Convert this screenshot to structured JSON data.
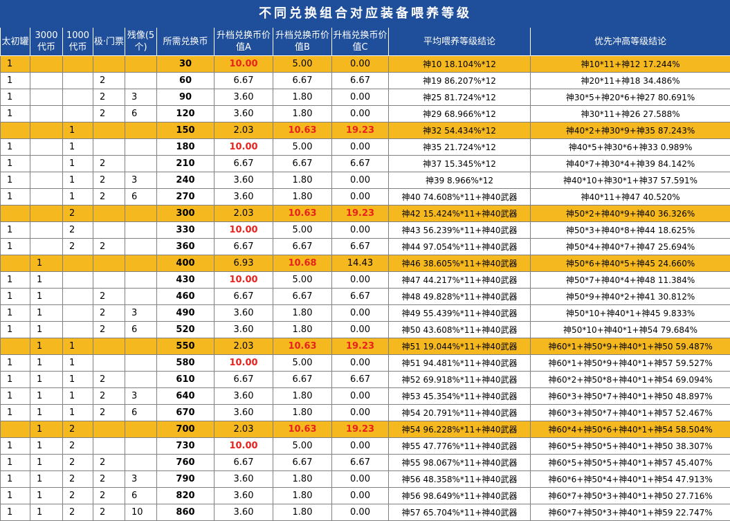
{
  "title": "不同兑换组合对应装备喂养等级",
  "headers": [
    "太初罐",
    "3000代币",
    "1000代币",
    "极·门票",
    "残像(5个)",
    "所需兑换币",
    "升档兑换币价值A",
    "升档兑换币价值B",
    "升档兑换币价值C",
    "平均喂养等级结论",
    "优先冲高等级结论"
  ],
  "highlight_color": "#f5b81f",
  "header_color": "#1f4e9a",
  "red_color": "#e8221c",
  "rows": [
    {
      "hl": true,
      "cells": [
        "1",
        "",
        "",
        "",
        "",
        "30",
        "10.00",
        "5.00",
        "0.00",
        "神10 18.104%*12",
        "神10*11+神12 17.244%"
      ],
      "red": [
        6
      ]
    },
    {
      "hl": false,
      "cells": [
        "1",
        "",
        "",
        "2",
        "",
        "60",
        "6.67",
        "6.67",
        "6.67",
        "神19 86.207%*12",
        "神20*11+神18 34.486%"
      ],
      "red": []
    },
    {
      "hl": false,
      "cells": [
        "1",
        "",
        "",
        "2",
        "3",
        "90",
        "3.60",
        "1.80",
        "0.00",
        "神25 81.724%*12",
        "神30*5+神20*6+神27 80.691%"
      ],
      "red": []
    },
    {
      "hl": false,
      "cells": [
        "1",
        "",
        "",
        "2",
        "6",
        "120",
        "3.60",
        "1.80",
        "0.00",
        "神29 68.966%*12",
        "神30*11+神26 27.588%"
      ],
      "red": []
    },
    {
      "hl": true,
      "cells": [
        "",
        "",
        "1",
        "",
        "",
        "150",
        "2.03",
        "10.63",
        "19.23",
        "神32 54.434%*12",
        "神40*2+神30*9+神35 87.243%"
      ],
      "red": [
        7,
        8
      ]
    },
    {
      "hl": false,
      "cells": [
        "1",
        "",
        "1",
        "",
        "",
        "180",
        "10.00",
        "5.00",
        "0.00",
        "神35 21.724%*12",
        "神40*5+神30*6+神33 0.989%"
      ],
      "red": [
        6
      ]
    },
    {
      "hl": false,
      "cells": [
        "1",
        "",
        "1",
        "2",
        "",
        "210",
        "6.67",
        "6.67",
        "6.67",
        "神37 15.345%*12",
        "神40*7+神30*4+神39 84.142%"
      ],
      "red": []
    },
    {
      "hl": false,
      "cells": [
        "1",
        "",
        "1",
        "2",
        "3",
        "240",
        "3.60",
        "1.80",
        "0.00",
        "神39 8.966%*12",
        "神40*10+神30*1+神37 57.591%"
      ],
      "red": []
    },
    {
      "hl": false,
      "cells": [
        "1",
        "",
        "1",
        "2",
        "6",
        "270",
        "3.60",
        "1.80",
        "0.00",
        "神40 74.608%*11+神40武器",
        "神40*11+神47 40.520%"
      ],
      "red": []
    },
    {
      "hl": true,
      "cells": [
        "",
        "",
        "2",
        "",
        "",
        "300",
        "2.03",
        "10.63",
        "19.23",
        "神42 15.424%*11+神40武器",
        "神50*2+神40*9+神40 36.326%"
      ],
      "red": [
        7,
        8
      ]
    },
    {
      "hl": false,
      "cells": [
        "1",
        "",
        "2",
        "",
        "",
        "330",
        "10.00",
        "5.00",
        "0.00",
        "神43 56.239%*11+神40武器",
        "神50*3+神40*8+神44 18.625%"
      ],
      "red": [
        6
      ]
    },
    {
      "hl": false,
      "cells": [
        "1",
        "",
        "2",
        "2",
        "",
        "360",
        "6.67",
        "6.67",
        "6.67",
        "神44 97.054%*11+神40武器",
        "神50*4+神40*7+神47 25.694%"
      ],
      "red": []
    },
    {
      "hl": true,
      "cells": [
        "",
        "1",
        "",
        "",
        "",
        "400",
        "6.93",
        "10.68",
        "14.43",
        "神46 38.605%*11+神40武器",
        "神50*6+神40*5+神45 24.660%"
      ],
      "red": [
        7
      ]
    },
    {
      "hl": false,
      "cells": [
        "1",
        "1",
        "",
        "",
        "",
        "430",
        "10.00",
        "5.00",
        "0.00",
        "神47 44.217%*11+神40武器",
        "神50*7+神40*4+神48 11.384%"
      ],
      "red": [
        6
      ]
    },
    {
      "hl": false,
      "cells": [
        "1",
        "1",
        "",
        "2",
        "",
        "460",
        "6.67",
        "6.67",
        "6.67",
        "神48 49.828%*11+神40武器",
        "神50*9+神40*2+神41 30.812%"
      ],
      "red": []
    },
    {
      "hl": false,
      "cells": [
        "1",
        "1",
        "",
        "2",
        "3",
        "490",
        "3.60",
        "1.80",
        "0.00",
        "神49 55.439%*11+神40武器",
        "神50*10+神40*1+神45 9.833%"
      ],
      "red": []
    },
    {
      "hl": false,
      "cells": [
        "1",
        "1",
        "",
        "2",
        "6",
        "520",
        "3.60",
        "1.80",
        "0.00",
        "神50 43.608%*11+神40武器",
        "神50*10+神40*1+神54 79.684%"
      ],
      "red": []
    },
    {
      "hl": true,
      "cells": [
        "",
        "1",
        "1",
        "",
        "",
        "550",
        "2.03",
        "10.63",
        "19.23",
        "神51 19.044%*11+神40武器",
        "神60*1+神50*9+神40*1+神50 59.487%"
      ],
      "red": [
        7,
        8
      ]
    },
    {
      "hl": false,
      "cells": [
        "1",
        "1",
        "1",
        "",
        "",
        "580",
        "10.00",
        "5.00",
        "0.00",
        "神51 94.481%*11+神40武器",
        "神60*1+神50*9+神40*1+神57 59.527%"
      ],
      "red": [
        6
      ]
    },
    {
      "hl": false,
      "cells": [
        "1",
        "1",
        "1",
        "2",
        "",
        "610",
        "6.67",
        "6.67",
        "6.67",
        "神52 69.918%*11+神40武器",
        "神60*2+神50*8+神40*1+神54 69.094%"
      ],
      "red": []
    },
    {
      "hl": false,
      "cells": [
        "1",
        "1",
        "1",
        "2",
        "3",
        "640",
        "3.60",
        "1.80",
        "0.00",
        "神53 45.354%*11+神40武器",
        "神60*3+神50*7+神40*1+神50 48.897%"
      ],
      "red": []
    },
    {
      "hl": false,
      "cells": [
        "1",
        "1",
        "1",
        "2",
        "6",
        "670",
        "3.60",
        "1.80",
        "0.00",
        "神54 20.791%*11+神40武器",
        "神60*3+神50*7+神40*1+神57 52.467%"
      ],
      "red": []
    },
    {
      "hl": true,
      "cells": [
        "",
        "1",
        "2",
        "",
        "",
        "700",
        "2.03",
        "10.63",
        "19.23",
        "神54 96.228%*11+神40武器",
        "神60*4+神50*6+神40*1+神54 58.504%"
      ],
      "red": [
        7,
        8
      ]
    },
    {
      "hl": false,
      "cells": [
        "1",
        "1",
        "2",
        "",
        "",
        "730",
        "10.00",
        "5.00",
        "0.00",
        "神55 47.776%*11+神40武器",
        "神60*5+神50*5+神40*1+神50 38.307%"
      ],
      "red": [
        6
      ]
    },
    {
      "hl": false,
      "cells": [
        "1",
        "1",
        "2",
        "2",
        "",
        "760",
        "6.67",
        "6.67",
        "6.67",
        "神55 98.067%*11+神40武器",
        "神60*5+神50*5+神40*1+神57 45.407%"
      ],
      "red": []
    },
    {
      "hl": false,
      "cells": [
        "1",
        "1",
        "2",
        "2",
        "3",
        "790",
        "3.60",
        "1.80",
        "0.00",
        "神56 48.358%*11+神40武器",
        "神60*6+神50*4+神40*1+神54 47.913%"
      ],
      "red": []
    },
    {
      "hl": false,
      "cells": [
        "1",
        "1",
        "2",
        "2",
        "6",
        "820",
        "3.60",
        "1.80",
        "0.00",
        "神56 98.649%*11+神40武器",
        "神60*7+神50*3+神40*1+神50 27.716%"
      ],
      "red": []
    },
    {
      "hl": false,
      "cells": [
        "1",
        "1",
        "2",
        "2",
        "10",
        "860",
        "3.60",
        "1.80",
        "0.00",
        "神57 65.704%*11+神40武器",
        "神60*7+神50*3+神40*1+神59 22.747%"
      ],
      "red": []
    }
  ]
}
